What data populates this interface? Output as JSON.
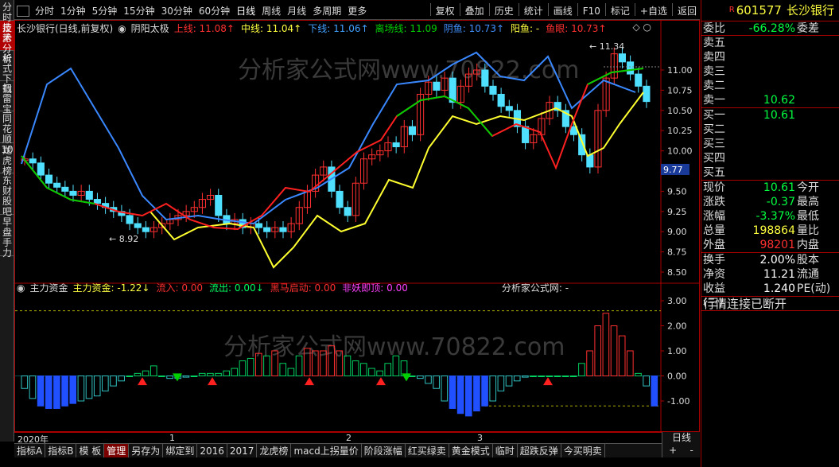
{
  "sidebar": {
    "tabs": [
      {
        "label": "分时走势",
        "active": false
      },
      {
        "label": "技术分析",
        "active": true
      },
      {
        "label": "公式下载",
        "active": false
      },
      {
        "label": "扫雷宝",
        "active": false
      },
      {
        "label": "同花顺10",
        "active": false
      },
      {
        "label": "龙虎榜",
        "active": false
      },
      {
        "label": "东财股吧",
        "active": false
      },
      {
        "label": "早盘手力",
        "active": false
      }
    ]
  },
  "toolbar": {
    "left": [
      "分时",
      "1分钟",
      "5分钟",
      "15分钟",
      "30分钟",
      "60分钟",
      "日线",
      "周线",
      "月线",
      "多周期",
      "更多"
    ],
    "selected": "日线",
    "right": [
      "复权",
      "叠加",
      "历史",
      "统计",
      "画线",
      "F10",
      "标记",
      "+自选",
      "返回"
    ]
  },
  "chart": {
    "title": "长沙银行(日线,前复权)",
    "indicator": "阴阳太极",
    "legend": [
      {
        "label": "上线: 11.08↑",
        "color": "#ff3030"
      },
      {
        "label": "中线: 11.04↑",
        "color": "#ffff40"
      },
      {
        "label": "下线: 11.06↑",
        "color": "#40a0ff"
      },
      {
        "label": "离场线: 11.09",
        "color": "#00d000"
      },
      {
        "label": "阴鱼: 10.73↑",
        "color": "#4090ff"
      },
      {
        "label": "阳鱼: -",
        "color": "#ffff40"
      },
      {
        "label": "鱼眼: 10.73↑",
        "color": "#ff3030"
      }
    ],
    "watermark": "分析家公式网www.70822.com",
    "price_ticks": [
      "11.00",
      "10.75",
      "10.50",
      "10.25",
      "10.00",
      "9.75",
      "9.50",
      "9.25",
      "9.00",
      "8.75",
      "8.50"
    ],
    "current_price_tag": "9.77",
    "high_annotation": "11.34",
    "low_annotation": "8.92"
  },
  "sub": {
    "title": "主力资金",
    "legend": [
      {
        "label": "主力资金: -1.22↓",
        "color": "#ffff40"
      },
      {
        "label": "流入: 0.00",
        "color": "#ff3030"
      },
      {
        "label": "流出: 0.00↓",
        "color": "#00ff60"
      },
      {
        "label": "黑马启动: 0.00",
        "color": "#ff3030"
      },
      {
        "label": "非妖即顶: 0.00",
        "color": "#ff40ff"
      },
      {
        "label": "分析家公式网: -",
        "color": "#dddddd"
      }
    ],
    "ticks": [
      "3.00",
      "2.00",
      "1.00",
      "0.00",
      "-1.00"
    ]
  },
  "datebar": {
    "year": "2020年",
    "marks": [
      "1",
      "2",
      "3"
    ]
  },
  "corner": {
    "label": "日线",
    "btn1": "+",
    "btn2": "-"
  },
  "bottom_tabs": [
    "指标A",
    "指标B",
    "模 板",
    "管理",
    "另存为",
    "绑定到",
    "2016",
    "2017",
    "龙虎榜",
    "macd上拐量价",
    "阶段涨幅",
    "红买绿卖",
    "黄金模式",
    "临时",
    "超跌反弹",
    "今买明卖"
  ],
  "bottom_active": "管理",
  "quote": {
    "badge": "R",
    "code": "601577",
    "name": "长沙银行",
    "weibi_label": "委比",
    "weibi": "-66.28%",
    "weicha_label": "委差",
    "asks": [
      {
        "l": "卖五",
        "v": ""
      },
      {
        "l": "卖四",
        "v": ""
      },
      {
        "l": "卖三",
        "v": ""
      },
      {
        "l": "卖二",
        "v": ""
      },
      {
        "l": "卖一",
        "v": "10.62"
      }
    ],
    "bids": [
      {
        "l": "买一",
        "v": "10.61"
      },
      {
        "l": "买二",
        "v": ""
      },
      {
        "l": "买三",
        "v": ""
      },
      {
        "l": "买四",
        "v": ""
      },
      {
        "l": "买五",
        "v": ""
      }
    ],
    "stats": [
      {
        "l": "现价",
        "v": "10.61",
        "c": "#00ff40",
        "r": "今开"
      },
      {
        "l": "涨跌",
        "v": "-0.37",
        "c": "#00ff40",
        "r": "最高"
      },
      {
        "l": "涨幅",
        "v": "-3.37%",
        "c": "#00ff40",
        "r": "最低"
      },
      {
        "l": "总量",
        "v": "198864",
        "c": "#ffff40",
        "r": "量比"
      },
      {
        "l": "外盘",
        "v": "98201",
        "c": "#ff3030",
        "r": "内盘"
      }
    ],
    "stats2": [
      {
        "l": "换手",
        "v": "2.00%",
        "c": "#ffffff",
        "r": "股本"
      },
      {
        "l": "净资",
        "v": "11.21",
        "c": "#ffffff",
        "r": "流通"
      },
      {
        "l": "收益(三)",
        "v": "1.240",
        "c": "#ffffff",
        "r": "PE(动)"
      }
    ],
    "status": "行情连接已断开"
  },
  "colors": {
    "up": "#ff3030",
    "down": "#50e0ff",
    "frame": "#aa0000"
  }
}
